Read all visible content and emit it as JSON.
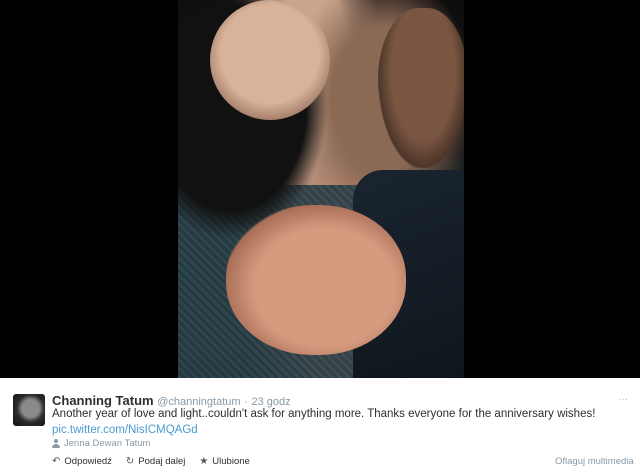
{
  "tweet": {
    "name": "Channing Tatum",
    "handle": "@channingtatum",
    "separator": "·",
    "time": "23 godz",
    "text": "Another year of love and light..couldn't ask for anything more. Thanks everyone for the anniversary wishes!",
    "link": "pic.twitter.com/NisICMQAGd",
    "tagged_user": "Jenna Dewan Tatum"
  },
  "actions": {
    "reply_label": "Odpowiedź",
    "retweet_label": "Podaj dalej",
    "favorite_label": "Ulubione",
    "flag_label": "Oflaguj multimedia"
  },
  "icons": {
    "reply": "reply-arrow-icon",
    "retweet": "retweet-icon",
    "favorite": "star-icon",
    "tagged": "person-icon",
    "more": "more-icon"
  },
  "colors": {
    "media_background": "#000000",
    "link": "#4a9bd1",
    "muted": "#8899a6",
    "text": "#292f33"
  }
}
